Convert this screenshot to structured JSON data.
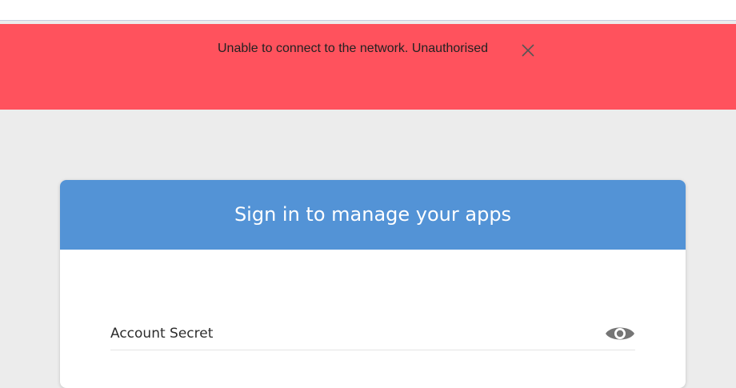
{
  "banner": {
    "message": "Unable to connect to the network. Unauthorised",
    "close_icon": "close-icon",
    "background_color": "#ff525d"
  },
  "card": {
    "title": "Sign in to manage your apps",
    "header_color": "#5393d6",
    "account_secret": {
      "placeholder": "Account Secret",
      "value": "",
      "toggle_icon": "eye-icon"
    }
  }
}
